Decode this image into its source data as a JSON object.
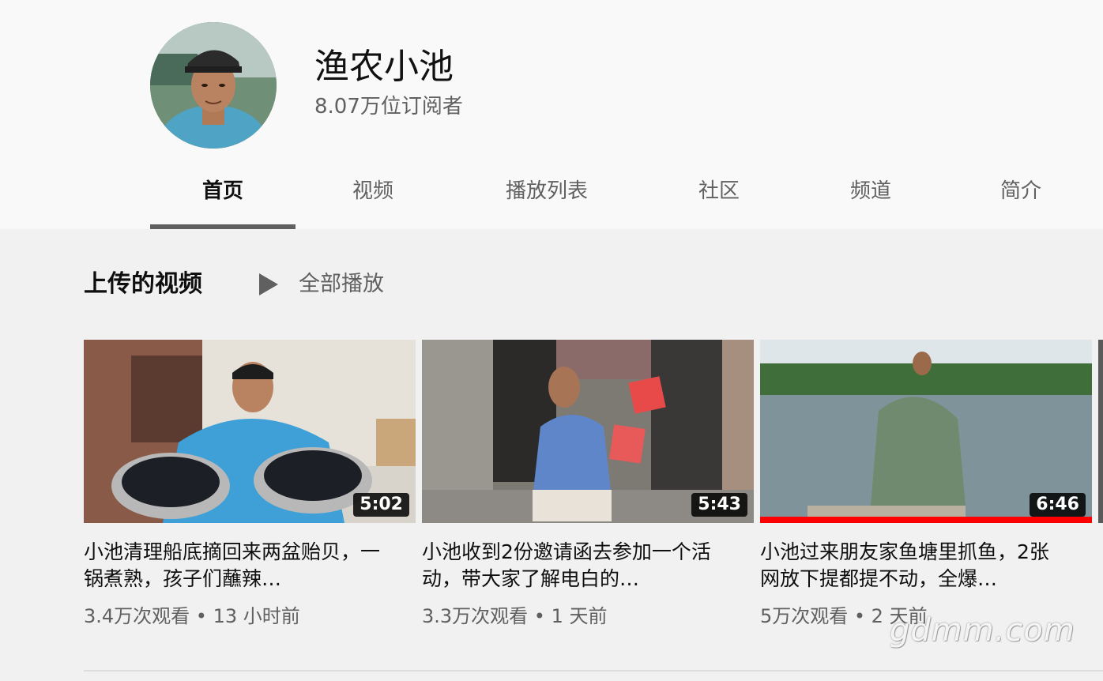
{
  "channel": {
    "name": "渔农小池",
    "subscribers": "8.07万位订阅者"
  },
  "tabs": [
    {
      "label": "首页",
      "active": true
    },
    {
      "label": "视频",
      "active": false
    },
    {
      "label": "播放列表",
      "active": false
    },
    {
      "label": "社区",
      "active": false
    },
    {
      "label": "频道",
      "active": false
    },
    {
      "label": "简介",
      "active": false
    }
  ],
  "section": {
    "title": "上传的视频",
    "play_all_label": "全部播放",
    "play_icon": "play-icon"
  },
  "videos": [
    {
      "title": "小池清理船底摘回来两盆贻贝，一锅煮熟，孩子们蘸辣…",
      "duration": "5:02",
      "views": "3.4万次观看",
      "age": "13 小时前",
      "meta": "3.4万次观看 • 13 小时前",
      "watched_fraction": 0
    },
    {
      "title": "小池收到2份邀请函去参加一个活动，带大家了解电白的…",
      "duration": "5:43",
      "views": "3.3万次观看",
      "age": "1 天前",
      "meta": "3.3万次观看 • 1 天前",
      "watched_fraction": 0
    },
    {
      "title": "小池过来朋友家鱼塘里抓鱼，2张网放下提都提不动，全爆…",
      "duration": "6:46",
      "views": "5万次观看",
      "age": "2 天前",
      "meta": "5万次观看 • 2 天前",
      "watched_fraction": 1.0
    }
  ],
  "watermark": "gdmm.com",
  "colors": {
    "progress": "#ff0000",
    "tab_underline": "#606060",
    "secondary_text": "#606060"
  }
}
